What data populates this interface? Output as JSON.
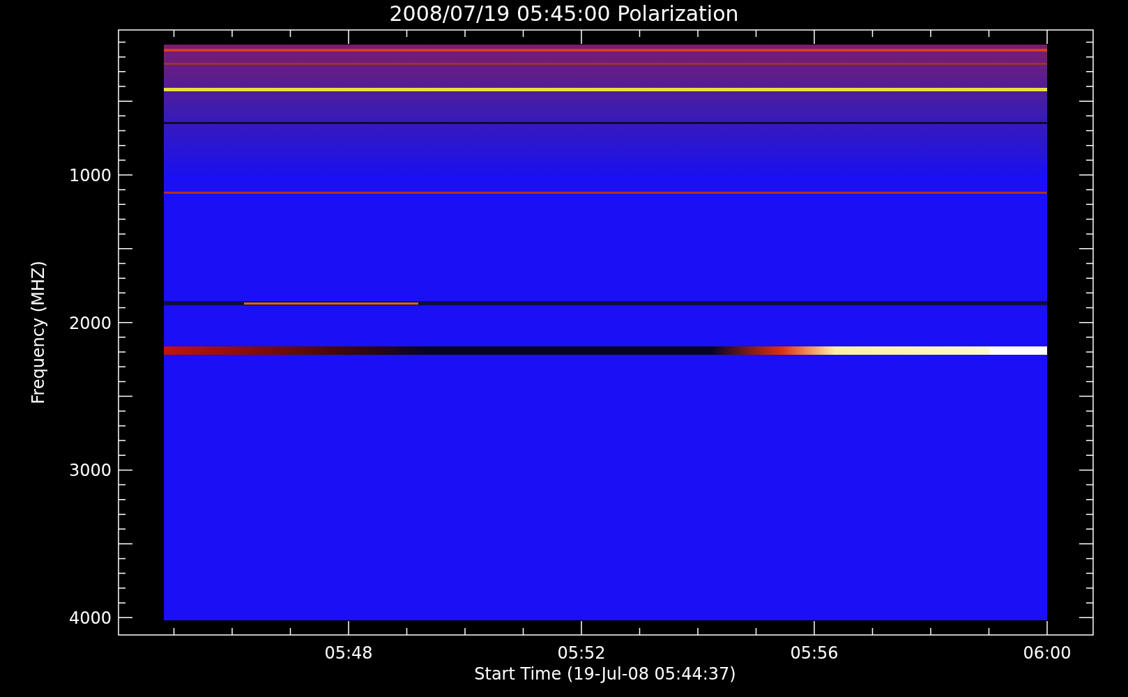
{
  "title": "2008/07/19 05:45:00 Polarization",
  "y_axis": {
    "label": "Frequency (MHZ)",
    "ticks": [
      "1000",
      "2000",
      "3000",
      "4000"
    ]
  },
  "x_axis": {
    "label": "Start Time (19-Jul-08 05:44:37)",
    "ticks": [
      "05:48",
      "05:52",
      "05:56",
      "06:00"
    ]
  }
}
